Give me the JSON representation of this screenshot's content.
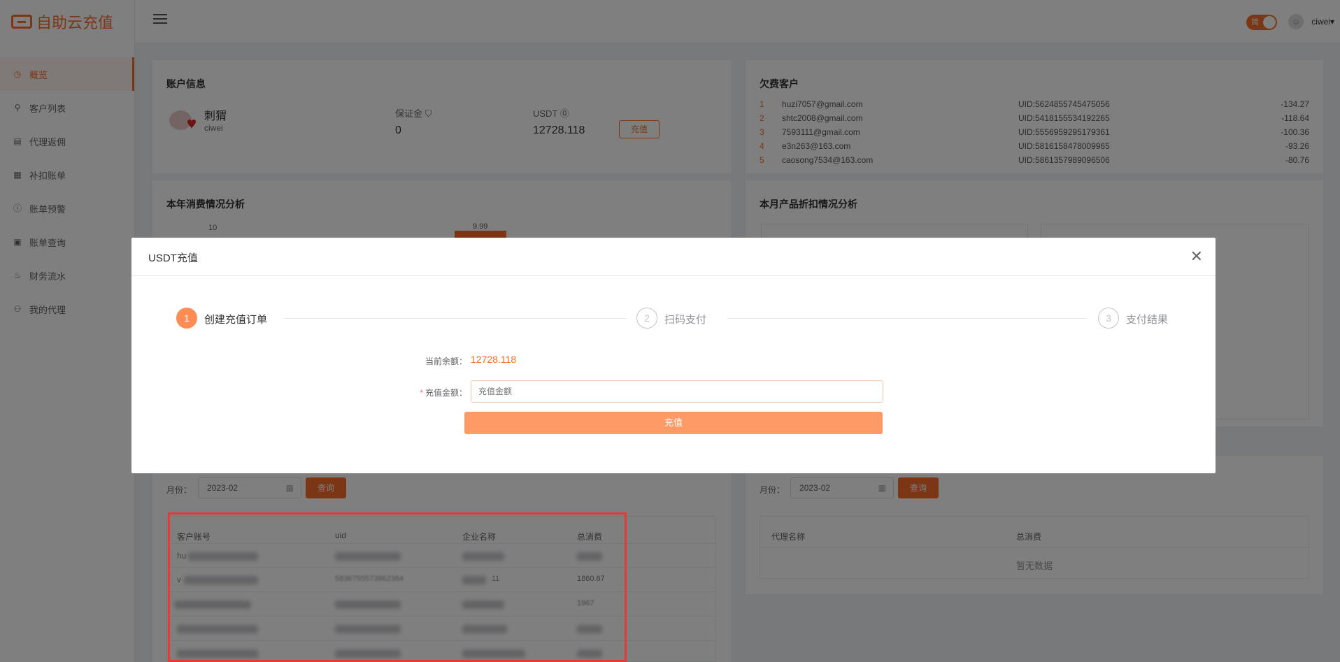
{
  "app": {
    "logo_text": "自助云充值"
  },
  "header": {
    "toggle_text": "简",
    "user_name": "ciwei▾"
  },
  "sidebar": {
    "items": [
      {
        "label": "概览",
        "icon": "dashboard-icon",
        "active": true
      },
      {
        "label": "客户列表",
        "icon": "user-icon"
      },
      {
        "label": "代理返佣",
        "icon": "document-icon"
      },
      {
        "label": "补扣账单",
        "icon": "calendar-icon"
      },
      {
        "label": "账单预警",
        "icon": "alert-icon"
      },
      {
        "label": "账单查询",
        "icon": "search-document-icon"
      },
      {
        "label": "财务流水",
        "icon": "finance-icon"
      },
      {
        "label": "我的代理",
        "icon": "agent-icon"
      }
    ]
  },
  "account": {
    "title": "账户信息",
    "name": "刺猬",
    "username": "ciwei",
    "deposit_label": "保证金",
    "deposit_value": "0",
    "usdt_label": "USDT",
    "usdt_value": "12728.118",
    "recharge_button": "充值"
  },
  "overdue": {
    "title": "欠费客户",
    "rows": [
      {
        "idx": "1",
        "email": "huzi7057@gmail.com",
        "uid": "UID:5624855745475056",
        "amount": "-134.27"
      },
      {
        "idx": "2",
        "email": "shtc2008@gmail.com",
        "uid": "UID:5418155534192265",
        "amount": "-118.64"
      },
      {
        "idx": "3",
        "email": "7593111@gmail.com",
        "uid": "UID:5556959295179361",
        "amount": "-100.36"
      },
      {
        "idx": "4",
        "email": "e3n263@163.com",
        "uid": "UID:5816158478009965",
        "amount": "-93.26"
      },
      {
        "idx": "5",
        "email": "caosong7534@163.com",
        "uid": "UID:5861357989096506",
        "amount": "-80.76"
      }
    ]
  },
  "yearly": {
    "title": "本年消费情况分析",
    "y_tick": "10",
    "bar_label": "9.99"
  },
  "monthly": {
    "title": "本月产品折扣情况分析"
  },
  "bottom_left": {
    "month_label": "月份：",
    "month_value": "2023-02",
    "query_button": "查询",
    "columns": [
      "客户账号",
      "uid",
      "企业名称",
      "总消费"
    ],
    "visible_cells": {
      "r0c0": "hu",
      "r1c0": "v",
      "r1c1": "5836755573862384",
      "r1c2": "11",
      "r1c3": "1860.67",
      "r2c3": "1967"
    }
  },
  "bottom_right": {
    "month_label": "月份：",
    "month_value": "2023-02",
    "query_button": "查询",
    "columns": [
      "代理名称",
      "总消费"
    ],
    "empty_text": "暂无数据"
  },
  "modal": {
    "title": "USDT充值",
    "steps": [
      {
        "num": "1",
        "label": "创建充值订单",
        "active": true
      },
      {
        "num": "2",
        "label": "扫码支付"
      },
      {
        "num": "3",
        "label": "支付结果"
      }
    ],
    "balance_label": "当前余额：",
    "balance_value": "12728.118",
    "amount_label": "充值金额：",
    "amount_required_mark": "*",
    "amount_placeholder": "充值金额",
    "submit_button": "充值"
  },
  "colors": {
    "accent": "#f56c2a",
    "highlight_frame": "#e43a3a"
  }
}
